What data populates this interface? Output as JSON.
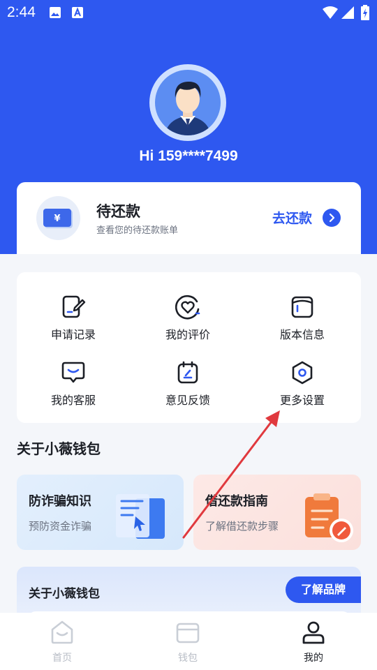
{
  "status_bar": {
    "time": "2:44"
  },
  "profile": {
    "greeting": "Hi 159****7499"
  },
  "repay_card": {
    "title": "待还款",
    "subtitle": "查看您的待还款账单",
    "action_label": "去还款",
    "icon_symbol": "¥"
  },
  "services": {
    "items": [
      {
        "label": "申请记录",
        "icon": "application-record-icon"
      },
      {
        "label": "我的评价",
        "icon": "heart-review-icon"
      },
      {
        "label": "版本信息",
        "icon": "version-info-icon"
      },
      {
        "label": "我的客服",
        "icon": "customer-service-icon"
      },
      {
        "label": "意见反馈",
        "icon": "feedback-icon"
      },
      {
        "label": "更多设置",
        "icon": "settings-hexagon-icon"
      }
    ]
  },
  "about_section": {
    "title": "关于小薇钱包",
    "cards": [
      {
        "title": "防诈骗知识",
        "subtitle": "预防资金诈骗"
      },
      {
        "title": "借还款指南",
        "subtitle": "了解借还款步骤"
      }
    ],
    "brand_card_title": "关于小薇钱包",
    "brand_button": "了解品牌"
  },
  "bottom_nav": {
    "items": [
      {
        "label": "首页",
        "active": false
      },
      {
        "label": "钱包",
        "active": false
      },
      {
        "label": "我的",
        "active": true
      }
    ]
  },
  "colors": {
    "primary": "#2e58f0",
    "annotation_arrow": "#e0393e"
  }
}
